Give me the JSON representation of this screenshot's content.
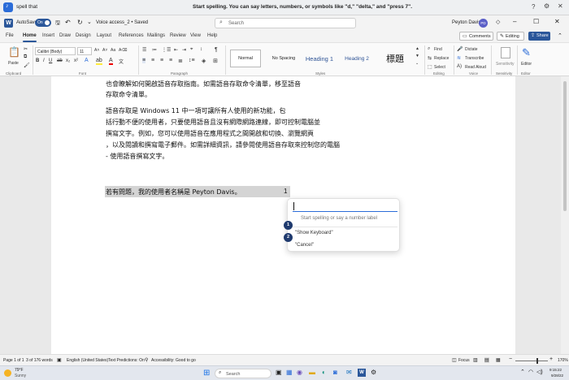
{
  "voice_access": {
    "command_text": "spell that",
    "status_text": "Start spelling. You can say letters, numbers, or symbols like \"d,\" \"delta,\" and \"press 7\"."
  },
  "title_bar": {
    "autosave_label": "AutoSave",
    "autosave_state": "On",
    "doc_name": "Voice access_2 • Saved",
    "search_placeholder": "Search",
    "user_name": "Peyton Davis",
    "user_initials": "PD"
  },
  "tabs": [
    "File",
    "Home",
    "Insert",
    "Draw",
    "Design",
    "Layout",
    "References",
    "Mailings",
    "Review",
    "View",
    "Help"
  ],
  "active_tab": "Home",
  "header_actions": {
    "comments": "Comments",
    "editing": "Editing",
    "share": "Share"
  },
  "ribbon": {
    "paste_label": "Paste",
    "font_name": "Calibri (Body)",
    "font_size": "11",
    "styles": [
      {
        "label": "Normal",
        "color": "#222222"
      },
      {
        "label": "No Spacing",
        "color": "#222222"
      },
      {
        "label": "Heading 1",
        "color": "#2f5496"
      },
      {
        "label": "Heading 2",
        "color": "#2f5496"
      },
      {
        "label": "標題",
        "color": "#111111"
      }
    ],
    "editing": {
      "find": "Find",
      "replace": "Replace",
      "select": "Select"
    },
    "voice": {
      "dictate": "Dictate",
      "transcribe": "Transcribe",
      "read_aloud": "Read Aloud"
    },
    "sensitivity": "Sensitivity",
    "editor": "Editor",
    "group_labels": {
      "clipboard": "Clipboard",
      "font": "Font",
      "paragraph": "Paragraph",
      "styles": "Styles",
      "editing": "Editing",
      "voice": "Voice",
      "sensitivity": "Sensitivity",
      "editor": "Editor"
    }
  },
  "document": {
    "lines": [
      "也會瞭解如何開啟語音存取指南。如需語音存取命令清單，移至語音",
      "存取命令清單。",
      "語音存取是 Windows 11 中一項可讓所有人使用的新功能，包",
      "括行動不便的使用者，只要使用語音且沒有網際網路連線，即可控制電腦並",
      "撰寫文字。例如，您可以使用語音在應用程式之間開啟和切換、瀏覽網頁",
      "，以及閱讀和撰寫電子郵件。如需詳細資訊，請參閱使用語音存取來控制您的電腦",
      "- 使用語音撰寫文字。"
    ],
    "selected_line": "若有問題，我的使用者名稱是 Peyton Davis。",
    "selection_badge": "1"
  },
  "spelling_panel": {
    "input_value": "",
    "placeholder": "Start spelling or say a number label",
    "options": [
      {
        "number": "1",
        "label": "\"Show Keyboard\""
      },
      {
        "number": "2",
        "label": "\"Cancel\""
      }
    ]
  },
  "status_bar": {
    "page": "Page 1 of 1",
    "words": "3 of 176 words",
    "language": "English (United States)",
    "text_predictions": "Text Predictions: On",
    "accessibility": "Accessibility: Good to go",
    "focus": "Focus",
    "zoom": "170%"
  },
  "taskbar": {
    "weather_temp": "79°F",
    "weather_desc": "Sunny",
    "search_placeholder": "Search",
    "time": "9:15:22",
    "date": "9/28/22"
  }
}
